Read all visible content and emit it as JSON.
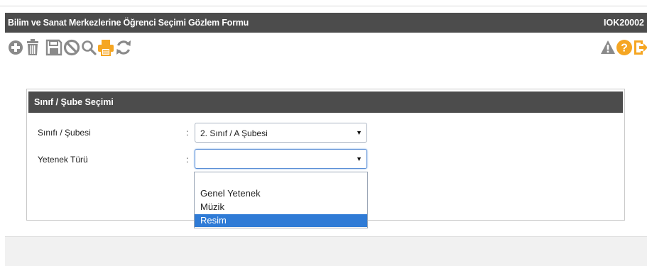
{
  "window": {
    "title": "Bilim ve Sanat Merkezlerine Öğrenci Seçimi Gözlem Formu",
    "code": "IOK20002"
  },
  "toolbar": {
    "left_icons": [
      "add-icon",
      "delete-icon",
      "save-icon",
      "cancel-icon",
      "search-icon",
      "print-icon",
      "refresh-icon"
    ],
    "right_icons": [
      "warning-icon",
      "help-icon",
      "exit-icon"
    ],
    "colors": {
      "gray": "#8a8a8a",
      "orange": "#f5a623"
    }
  },
  "panel": {
    "title": "Sınıf / Şube Seçimi",
    "fields": {
      "class_label": "Sınıfı / Şubesi",
      "class_value": "2. Sınıf / A Şubesi",
      "talent_label": "Yetenek Türü",
      "talent_value": "",
      "separator": ":"
    }
  },
  "dropdown": {
    "options": [
      "",
      "Genel Yetenek",
      "Müzik",
      "Resim"
    ],
    "selected": "Resim",
    "highlight_color": "#2f7bd6"
  }
}
